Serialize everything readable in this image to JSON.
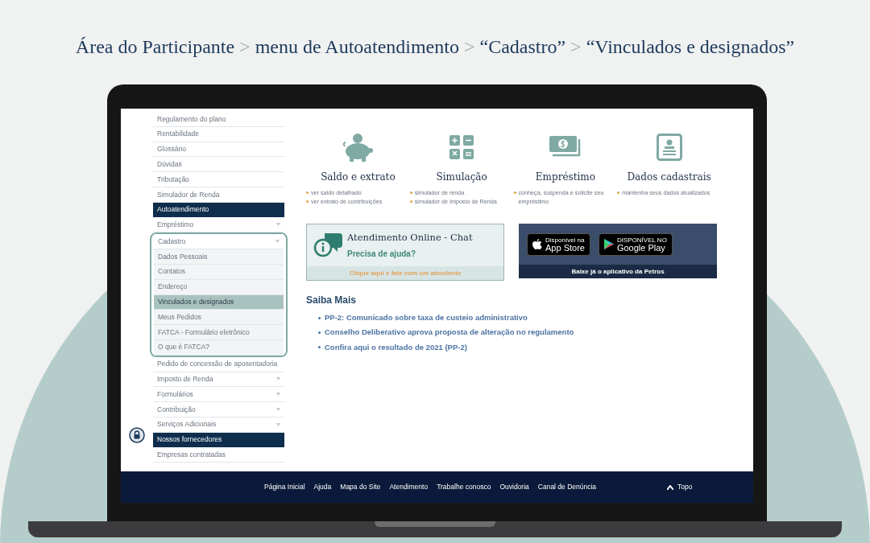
{
  "headline": {
    "crumbs": [
      "Área do Participante",
      "menu de Autoatendimento",
      "“Cadastro”",
      "“Vinculados e designados”"
    ],
    "separator": ">"
  },
  "sidebar": {
    "items": [
      {
        "label": "Regulamento do plano",
        "kind": "link",
        "expandable": false
      },
      {
        "label": "Rentabilidade",
        "kind": "link",
        "expandable": false
      },
      {
        "label": "Glossário",
        "kind": "link",
        "expandable": false
      },
      {
        "label": "Dúvidas",
        "kind": "link",
        "expandable": false
      },
      {
        "label": "Tributação",
        "kind": "link",
        "expandable": false
      },
      {
        "label": "Simulador de Renda",
        "kind": "link",
        "expandable": false
      },
      {
        "label": "Autoatendimento",
        "kind": "section"
      },
      {
        "label": "Empréstimo",
        "kind": "link",
        "expandable": true
      },
      {
        "label": "Cadastro",
        "kind": "link",
        "expandable": true,
        "expanded": true,
        "children": [
          {
            "label": "Dados Pessoais",
            "selected": false
          },
          {
            "label": "Contatos",
            "selected": false
          },
          {
            "label": "Endereço",
            "selected": false
          },
          {
            "label": "Vinculados e designados",
            "selected": true
          },
          {
            "label": "Meus Pedidos",
            "selected": false
          },
          {
            "label": "FATCA - Formulário eletrônico",
            "selected": false
          },
          {
            "label": "O que é FATCA?",
            "selected": false
          }
        ]
      },
      {
        "label": "Pedido de concessão de aposentadoria",
        "kind": "link",
        "expandable": false
      },
      {
        "label": "Imposto de Renda",
        "kind": "link",
        "expandable": true
      },
      {
        "label": "Formulários",
        "kind": "link",
        "expandable": true
      },
      {
        "label": "Contribuição",
        "kind": "link",
        "expandable": true
      },
      {
        "label": "Serviços Adicionais",
        "kind": "link",
        "expandable": true
      },
      {
        "label": "Nossos fornecedores",
        "kind": "section"
      },
      {
        "label": "Empresas contratadas",
        "kind": "link",
        "expandable": false
      }
    ]
  },
  "features": [
    {
      "kind": "piggy",
      "title": "Saldo e extrato",
      "bullets": [
        "ver saldo detalhado",
        "ver extrato de contribuições"
      ]
    },
    {
      "kind": "calculator",
      "title": "Simulação",
      "bullets": [
        "simulador de renda",
        "simulador de Imposto de Renda"
      ]
    },
    {
      "kind": "money",
      "title": "Empréstimo",
      "bullets": [
        "conheça, suspenda e solicite seu empréstimo"
      ]
    },
    {
      "kind": "profile",
      "title": "Dados cadastrais",
      "bullets": [
        "mantenha seus dados atualizados"
      ]
    }
  ],
  "chat": {
    "title": "Atendimento Online - Chat",
    "subtitle": "Precisa de ajuda?",
    "action": "Clique aqui e fale com um atendente"
  },
  "app_banner": {
    "badges": [
      {
        "kind": "apple",
        "small": "Disponível na",
        "name": "App Store"
      },
      {
        "kind": "google",
        "small": "DISPONÍVEL NO",
        "name": "Google Play"
      }
    ],
    "caption": "Baixe já o aplicativo da Petros"
  },
  "news": {
    "title": "Saiba Mais",
    "items": [
      "PP-2: Comunicado sobre taxa de custeio administrativo",
      "Conselho Deliberativo aprova proposta de alteração no regulamento",
      "Confira aqui o resultado de 2021 (PP-2)"
    ]
  },
  "footer": {
    "links": [
      "Página Inicial",
      "Ajuda",
      "Mapa do Site",
      "Atendimento",
      "Trabalhe conosco",
      "Ouvidoria",
      "Canal de Denúncia"
    ],
    "top": "Topo"
  }
}
